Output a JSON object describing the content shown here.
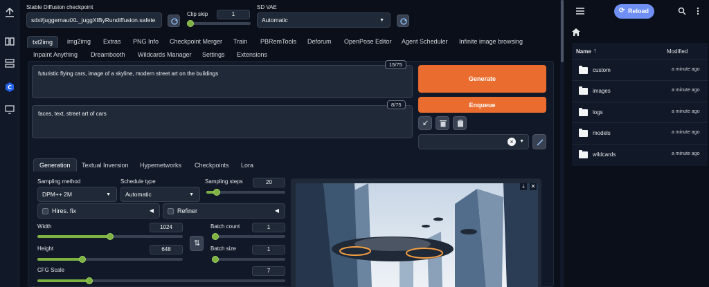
{
  "top": {
    "checkpoint_label": "Stable Diffusion checkpoint",
    "checkpoint_value": "sdxl/juggernautXL_juggXIByRundiffusion.safete",
    "clip_skip_label": "Clip skip",
    "clip_skip_value": "1",
    "clip_skip_fraction": 0.0,
    "vae_label": "SD VAE",
    "vae_value": "Automatic"
  },
  "tabs_row1": [
    "txt2img",
    "img2img",
    "Extras",
    "PNG Info",
    "Checkpoint Merger",
    "Train",
    "PBRemTools",
    "Deforum",
    "OpenPose Editor",
    "Agent Scheduler",
    "Infinite image browsing"
  ],
  "tabs_row2": [
    "Inpaint Anything",
    "Dreambooth",
    "Wildcards Manager",
    "Settings",
    "Extensions"
  ],
  "prompt": {
    "positive": "futuristic flying cars, image of a skyline, modern street art on the buildings",
    "positive_count": "15/75",
    "negative": "faces, text, street art of cars",
    "negative_count": "8/75"
  },
  "buttons": {
    "generate": "Generate",
    "enqueue": "Enqueue",
    "clear_style": "×"
  },
  "subtabs": [
    "Generation",
    "Textual Inversion",
    "Hypernetworks",
    "Checkpoints",
    "Lora"
  ],
  "generation": {
    "sampling_method_label": "Sampling method",
    "sampling_method_value": "DPM++ 2M",
    "schedule_type_label": "Schedule type",
    "schedule_type_value": "Automatic",
    "sampling_steps_label": "Sampling steps",
    "sampling_steps_value": "20",
    "sampling_steps_fraction": 0.13,
    "hires_label": "Hires. fix",
    "refiner_label": "Refiner",
    "width_label": "Width",
    "width_value": "1024",
    "width_fraction": 0.5,
    "height_label": "Height",
    "height_value": "648",
    "height_fraction": 0.31,
    "batch_count_label": "Batch count",
    "batch_count_value": "1",
    "batch_count_fraction": 0.0,
    "batch_size_label": "Batch size",
    "batch_size_value": "1",
    "batch_size_fraction": 0.0,
    "cfg_label": "CFG Scale",
    "cfg_value": "7",
    "cfg_fraction": 0.21
  },
  "file_browser": {
    "reload_label": "Reload",
    "col_name": "Name",
    "col_modified": "Modified",
    "rows": [
      {
        "name": "custom",
        "modified": "a minute ago"
      },
      {
        "name": "images",
        "modified": "a minute ago"
      },
      {
        "name": "logs",
        "modified": "a minute ago"
      },
      {
        "name": "models",
        "modified": "a minute ago"
      },
      {
        "name": "wildcards",
        "modified": "a minute ago"
      }
    ]
  },
  "colors": {
    "accent": "#ea6d2f",
    "slider": "#7db243",
    "reload": "#6f8ff4",
    "background": "#0b0f19"
  }
}
